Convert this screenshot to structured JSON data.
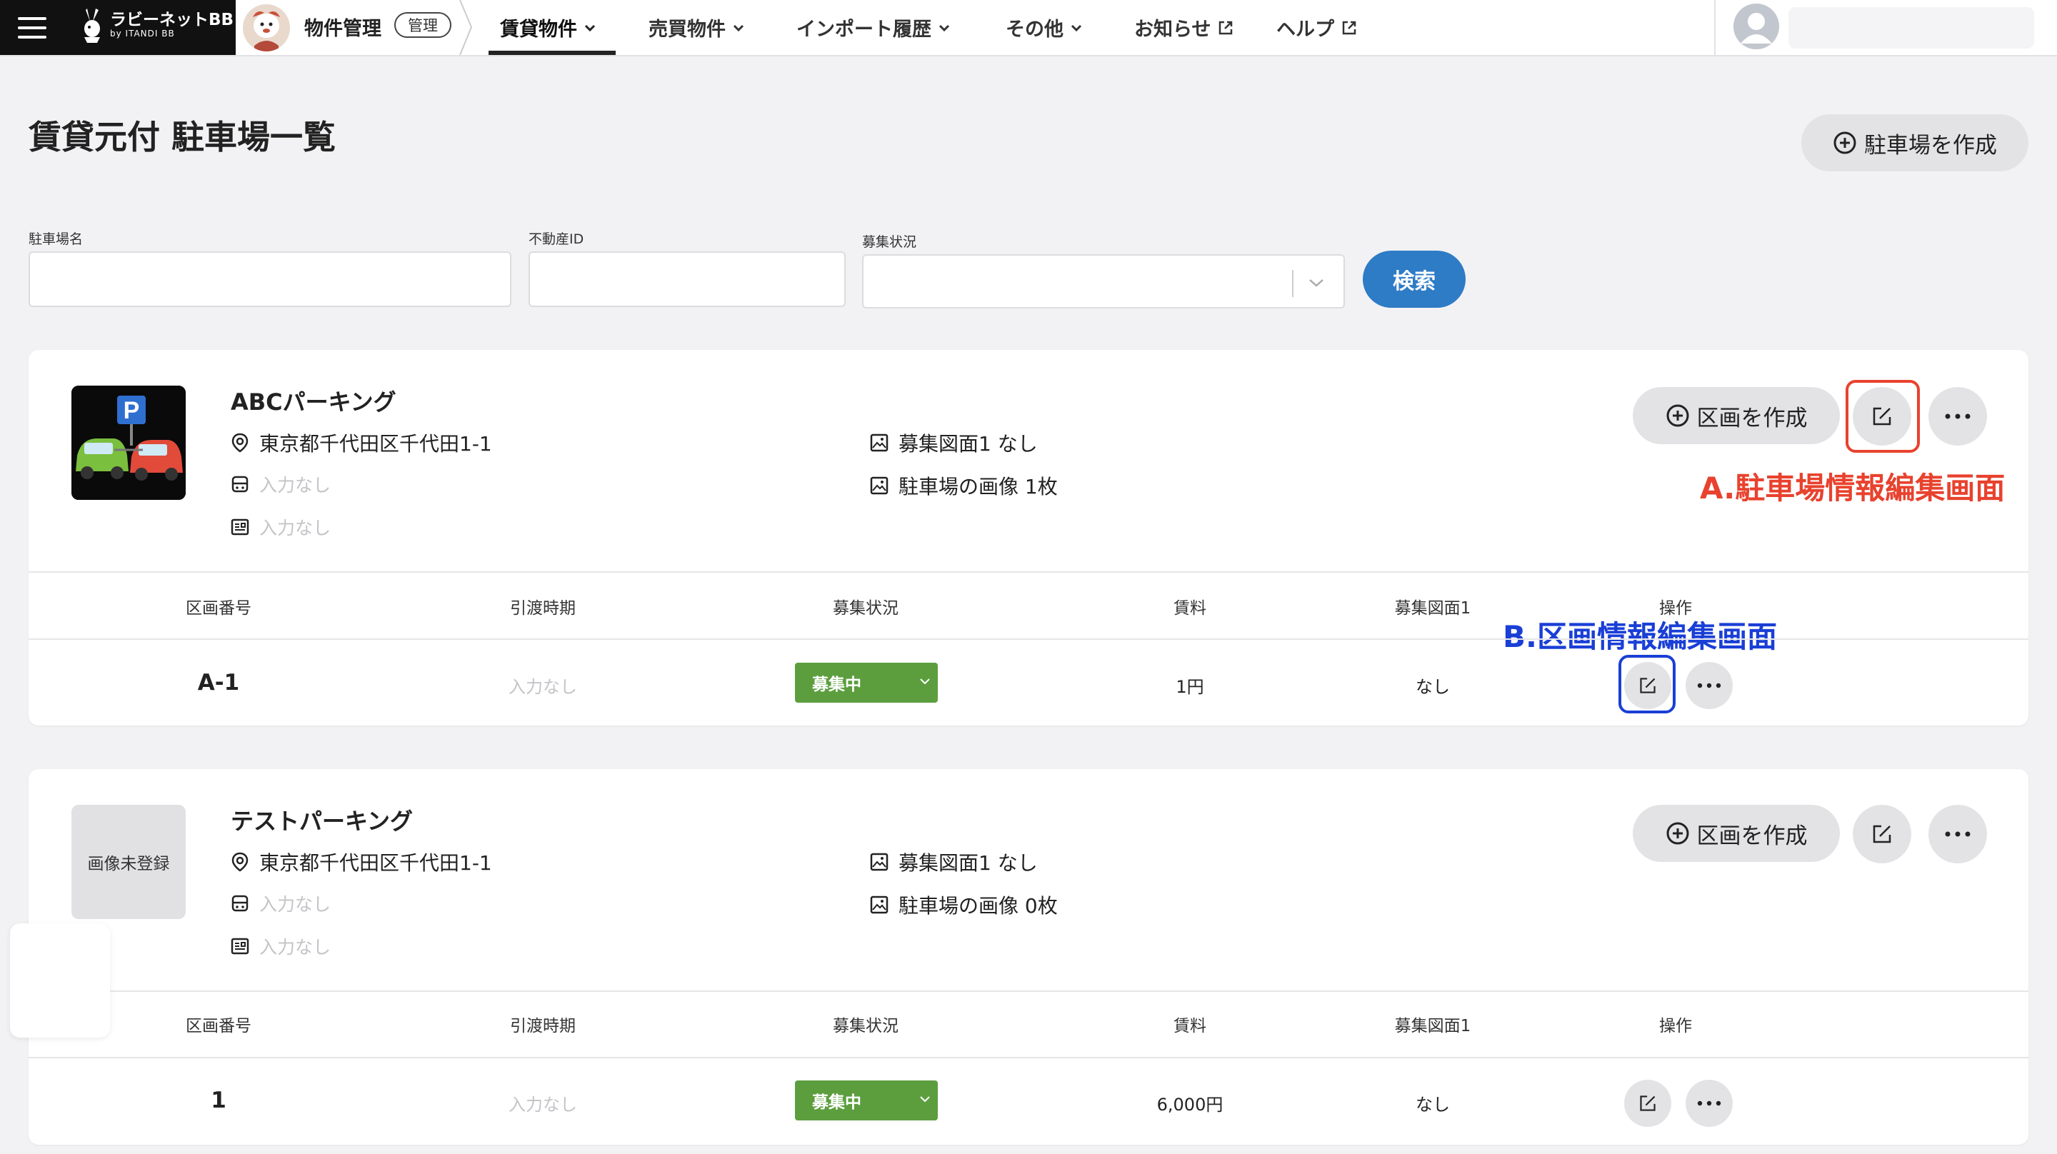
{
  "header": {
    "logo_main": "ラビーネットBB",
    "logo_sub": "by ITANDI BB",
    "module_label": "物件管理",
    "module_badge": "管理",
    "nav": [
      {
        "label": "賃貸物件",
        "icon": "chevron-down-icon",
        "active": true
      },
      {
        "label": "売買物件",
        "icon": "chevron-down-icon"
      },
      {
        "label": "インポート履歴",
        "icon": "chevron-down-icon"
      },
      {
        "label": "その他",
        "icon": "chevron-down-icon"
      },
      {
        "label": "お知らせ",
        "icon": "external-link-icon"
      },
      {
        "label": "ヘルプ",
        "icon": "external-link-icon"
      }
    ]
  },
  "page": {
    "title": "賃貸元付 駐車場一覧",
    "create_button": "駐車場を作成"
  },
  "search": {
    "parking_name_label": "駐車場名",
    "property_id_label": "不動産ID",
    "status_label": "募集状況",
    "submit_label": "検索"
  },
  "table_headers": [
    "区画番号",
    "引渡時期",
    "募集状況",
    "賃料",
    "募集図面1",
    "操作"
  ],
  "parkings": [
    {
      "name": "ABCパーキング",
      "address": "東京都千代田区千代田1-1",
      "station": "入力なし",
      "note": "入力なし",
      "drawing": "募集図面1 なし",
      "images": "駐車場の画像 1枚",
      "create_section_label": "区画を作成",
      "annotation": "A.駐車場情報編集画面",
      "sections": [
        {
          "code": "A-1",
          "delivery": "入力なし",
          "status": "募集中",
          "rent": "1円",
          "drawing": "なし"
        }
      ],
      "section_annotation": "B.区画情報編集画面"
    },
    {
      "name": "テストパーキング",
      "thumb_text": "画像未登録",
      "address": "東京都千代田区千代田1-1",
      "station": "入力なし",
      "note": "入力なし",
      "drawing": "募集図面1 なし",
      "images": "駐車場の画像 0枚",
      "create_section_label": "区画を作成",
      "sections": [
        {
          "code": "1",
          "delivery": "入力なし",
          "status": "募集中",
          "rent": "6,000円",
          "drawing": "なし"
        }
      ]
    }
  ],
  "colors": {
    "accent_blue": "#2e7bc6",
    "status_green": "#5c9e3e",
    "annotation_red": "#e8422e",
    "annotation_blue": "#1a3fd6"
  }
}
